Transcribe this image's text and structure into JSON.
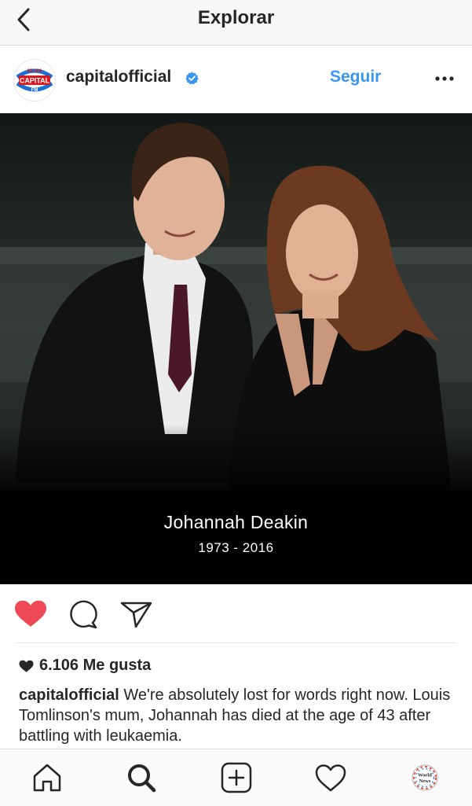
{
  "topbar": {
    "title": "Explorar"
  },
  "post": {
    "username": "capitalofficial",
    "verified": true,
    "follow_label": "Seguir",
    "avatar_logo": {
      "line1": "95-106",
      "line2": "CAPITAL",
      "line3": "FM"
    },
    "memorial": {
      "name": "Johannah Deakin",
      "years": "1973 - 2016"
    },
    "liked": true,
    "likes_text": "6.106 Me gusta",
    "caption_user": "capitalofficial",
    "caption_text": " We're absolutely lost for words right now. Louis Tomlinson's mum, Johannah has died at the age of 43 after battling with leukaemia."
  },
  "bottom_nav": {
    "items": [
      "home-icon",
      "search-icon",
      "new-post-icon",
      "activity-heart-icon",
      "profile-avatar"
    ],
    "active": "search-icon",
    "profile_logo": {
      "line1": "World",
      "line2": "News"
    }
  },
  "colors": {
    "accent": "#3897f0",
    "like_red": "#ed4956",
    "text": "#262626",
    "verified_blue": "#3897f0",
    "topbar_bg": "#f7f7f7"
  }
}
